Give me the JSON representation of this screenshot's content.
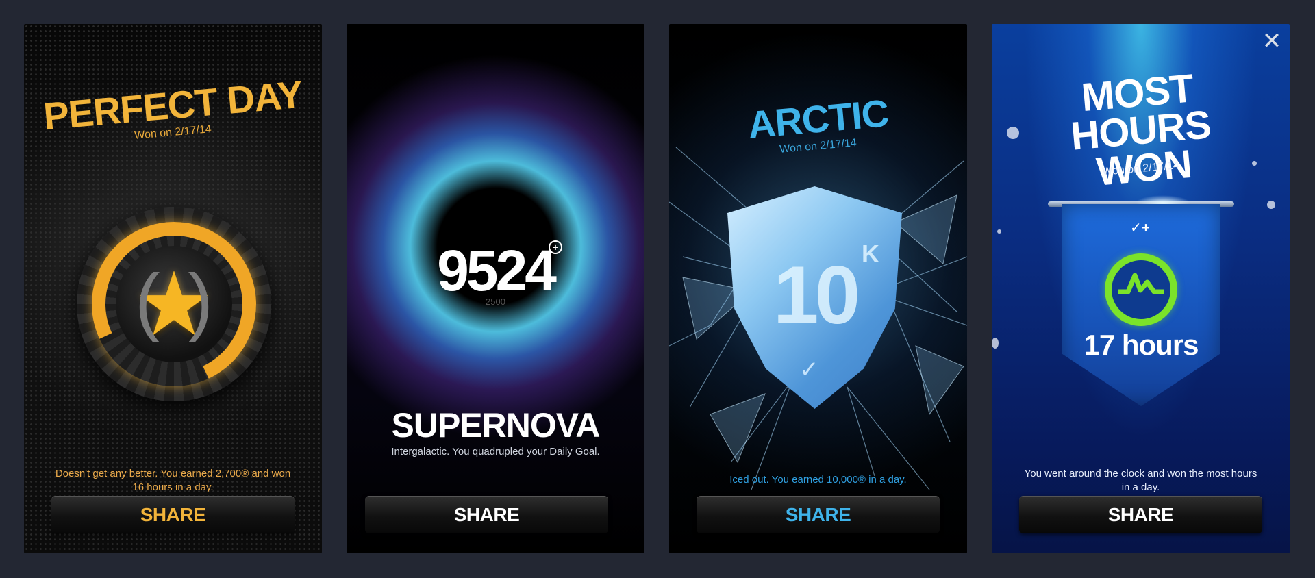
{
  "cards": {
    "perfect_day": {
      "title": "PERFECT DAY",
      "won": "Won on 2/17/14",
      "description": "Doesn't get any better. You earned 2,700® and won 16 hours in a day.",
      "share_label": "SHARE",
      "accent": "#f2b43a",
      "icon": "gold-star-medal-icon"
    },
    "supernova": {
      "score": "9524",
      "goal": "2500",
      "title": "SUPERNOVA",
      "description": "Intergalactic. You quadrupled your Daily Goal.",
      "share_label": "SHARE",
      "accent": "#ffffff",
      "icon": "fuel-plus-icon"
    },
    "arctic": {
      "title": "ARCTIC",
      "won": "Won on 2/17/14",
      "shield_value": "10",
      "shield_unit": "K",
      "description": "Iced out. You earned 10,000® in a day.",
      "share_label": "SHARE",
      "accent": "#3fb3ea",
      "icon": "ice-shield-icon"
    },
    "most_hours": {
      "title": "MOST HOURS WON",
      "won": "Won on 2/17/14",
      "hours": "17 hours",
      "description": "You went around the clock and won the most hours in a day.",
      "share_label": "SHARE",
      "accent": "#7be32a",
      "icon": "nike-plus-banner-icon"
    }
  },
  "close_icon": "close-icon"
}
